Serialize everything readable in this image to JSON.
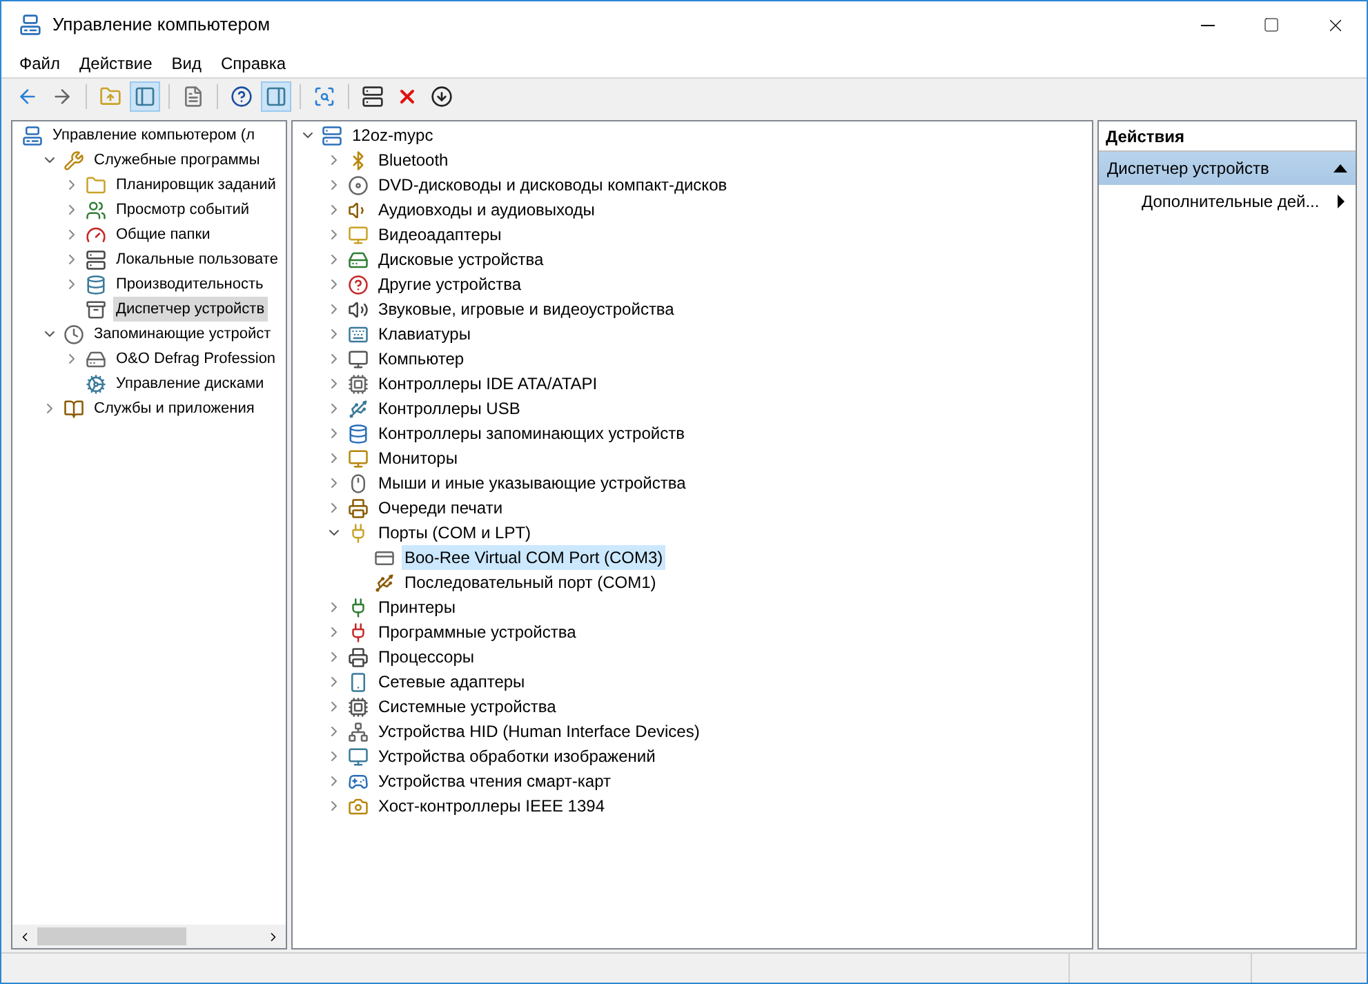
{
  "window": {
    "title": "Управление компьютером"
  },
  "menu": [
    "Файл",
    "Действие",
    "Вид",
    "Справка"
  ],
  "toolbar": [
    {
      "pressed": false
    },
    {
      "pressed": false
    },
    {
      "pressed": false
    },
    {
      "pressed": true
    },
    {
      "pressed": false
    },
    {
      "pressed": false
    },
    {
      "pressed": true
    },
    {
      "pressed": false
    },
    {
      "pressed": false
    },
    {
      "pressed": false
    },
    {
      "pressed": false
    }
  ],
  "sidebar": {
    "items": [
      {
        "label": "Управление компьютером (л",
        "kind": "root",
        "selected": false,
        "children": [
          {
            "label": "Служебные программы",
            "kind": "node",
            "expanded": true,
            "selected": false,
            "children": [
              {
                "label": "Планировщик заданий",
                "kind": "node",
                "expanded": false,
                "selected": false
              },
              {
                "label": "Просмотр событий",
                "kind": "node",
                "expanded": false,
                "selected": false
              },
              {
                "label": "Общие папки",
                "kind": "node",
                "expanded": false,
                "selected": false
              },
              {
                "label": "Локальные пользовате",
                "kind": "node",
                "expanded": false,
                "selected": false
              },
              {
                "label": "Производительность",
                "kind": "node",
                "expanded": false,
                "selected": false
              },
              {
                "label": "Диспетчер устройств",
                "kind": "leaf",
                "selected": true
              }
            ]
          },
          {
            "label": "Запоминающие устройст",
            "kind": "node",
            "expanded": true,
            "selected": false,
            "children": [
              {
                "label": "O&O Defrag Profession",
                "kind": "node",
                "expanded": false,
                "selected": false
              },
              {
                "label": "Управление дисками",
                "kind": "leaf",
                "selected": false
              }
            ]
          },
          {
            "label": "Службы и приложения",
            "kind": "node",
            "expanded": false,
            "selected": false
          }
        ]
      }
    ]
  },
  "device_tree": {
    "items": [
      {
        "label": "12oz-mypc",
        "kind": "node",
        "expanded": true,
        "selected": false,
        "children": [
          {
            "label": "Bluetooth",
            "kind": "node",
            "expanded": false,
            "selected": false
          },
          {
            "label": "DVD-дисководы и дисководы компакт-дисков",
            "kind": "node",
            "expanded": false,
            "selected": false
          },
          {
            "label": "Аудиовходы и аудиовыходы",
            "kind": "node",
            "expanded": false,
            "selected": false
          },
          {
            "label": "Видеоадаптеры",
            "kind": "node",
            "expanded": false,
            "selected": false
          },
          {
            "label": "Дисковые устройства",
            "kind": "node",
            "expanded": false,
            "selected": false
          },
          {
            "label": "Другие устройства",
            "kind": "node",
            "expanded": false,
            "selected": false
          },
          {
            "label": "Звуковые, игровые и видеоустройства",
            "kind": "node",
            "expanded": false,
            "selected": false
          },
          {
            "label": "Клавиатуры",
            "kind": "node",
            "expanded": false,
            "selected": false
          },
          {
            "label": "Компьютер",
            "kind": "node",
            "expanded": false,
            "selected": false
          },
          {
            "label": "Контроллеры IDE ATA/ATAPI",
            "kind": "node",
            "expanded": false,
            "selected": false
          },
          {
            "label": "Контроллеры USB",
            "kind": "node",
            "expanded": false,
            "selected": false
          },
          {
            "label": "Контроллеры запоминающих устройств",
            "kind": "node",
            "expanded": false,
            "selected": false
          },
          {
            "label": "Мониторы",
            "kind": "node",
            "expanded": false,
            "selected": false
          },
          {
            "label": "Мыши и иные указывающие устройства",
            "kind": "node",
            "expanded": false,
            "selected": false
          },
          {
            "label": "Очереди печати",
            "kind": "node",
            "expanded": false,
            "selected": false
          },
          {
            "label": "Порты (COM и LPT)",
            "kind": "node",
            "expanded": true,
            "selected": false,
            "children": [
              {
                "label": "Boo-Ree Virtual COM Port (COM3)",
                "kind": "leaf",
                "selected": true
              },
              {
                "label": "Последовательный порт (COM1)",
                "kind": "leaf",
                "selected": false
              }
            ]
          },
          {
            "label": "Принтеры",
            "kind": "node",
            "expanded": false,
            "selected": false
          },
          {
            "label": "Программные устройства",
            "kind": "node",
            "expanded": false,
            "selected": false
          },
          {
            "label": "Процессоры",
            "kind": "node",
            "expanded": false,
            "selected": false
          },
          {
            "label": "Сетевые адаптеры",
            "kind": "node",
            "expanded": false,
            "selected": false
          },
          {
            "label": "Системные устройства",
            "kind": "node",
            "expanded": false,
            "selected": false
          },
          {
            "label": "Устройства HID (Human Interface Devices)",
            "kind": "node",
            "expanded": false,
            "selected": false
          },
          {
            "label": "Устройства обработки изображений",
            "kind": "node",
            "expanded": false,
            "selected": false
          },
          {
            "label": "Устройства чтения смарт-карт",
            "kind": "node",
            "expanded": false,
            "selected": false
          },
          {
            "label": "Хост-контроллеры IEEE 1394",
            "kind": "node",
            "expanded": false,
            "selected": false
          }
        ]
      }
    ]
  },
  "actions": {
    "title": "Действия",
    "section": {
      "label": "Диспетчер устройств",
      "expanded": true
    },
    "items": [
      "Дополнительные дей..."
    ]
  }
}
